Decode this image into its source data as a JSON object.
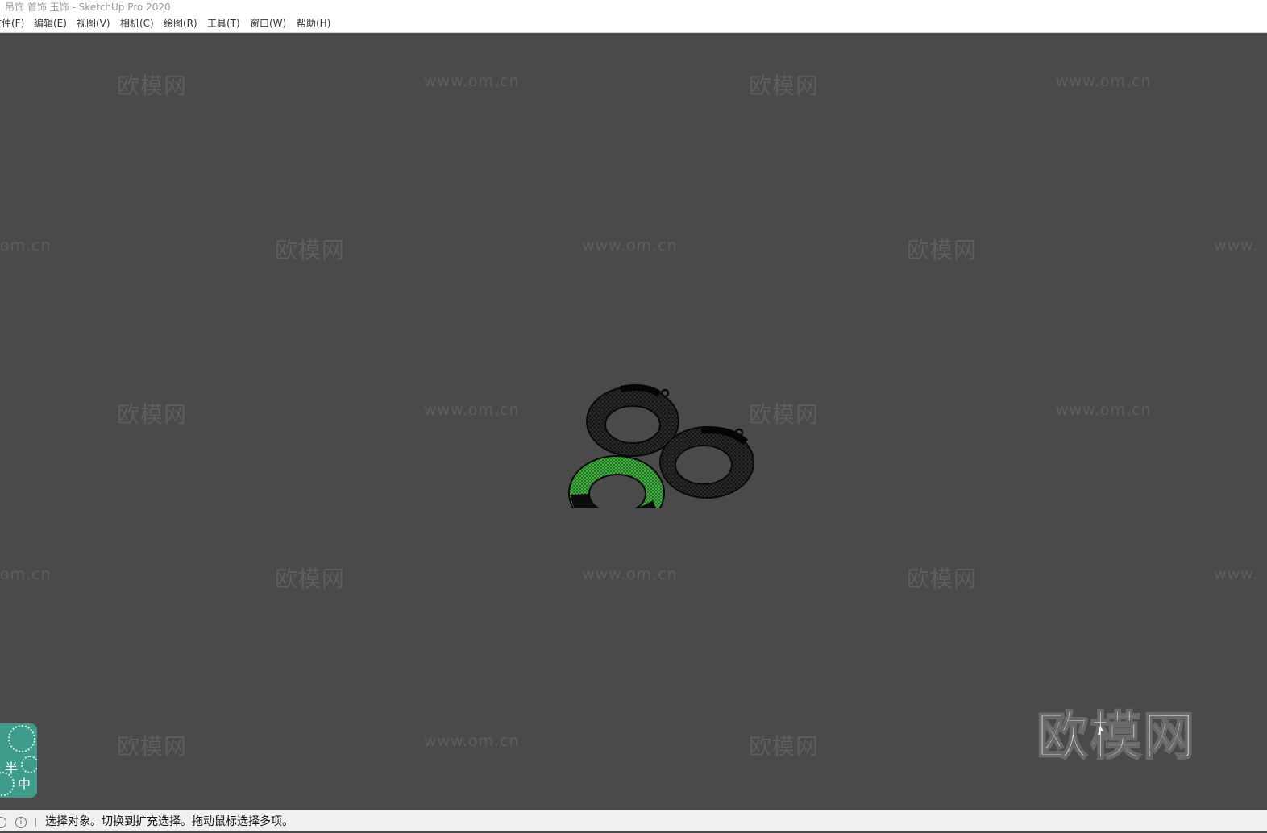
{
  "window": {
    "title": "吊饰 首饰 玉饰 - SketchUp Pro 2020"
  },
  "menu": {
    "items": [
      {
        "label": "文件(F)"
      },
      {
        "label": "编辑(E)"
      },
      {
        "label": "视图(V)"
      },
      {
        "label": "相机(C)"
      },
      {
        "label": "绘图(R)"
      },
      {
        "label": "工具(T)"
      },
      {
        "label": "窗口(W)"
      },
      {
        "label": "帮助(H)"
      }
    ]
  },
  "watermark": {
    "brand_text": "欧模网",
    "url_text": "www.om.cn",
    "url_partial_left": "om.cn",
    "url_partial_right": "www."
  },
  "logo": {
    "text": "欧模网"
  },
  "badge": {
    "char_top": "半",
    "char_bottom": "中"
  },
  "status": {
    "message": "选择对象。切换到扩充选择。拖动鼠标选择多项。",
    "info_icon": "info-icon",
    "geo_icon": "geolocation-icon"
  },
  "model": {
    "description_colors": {
      "ring": "#111111",
      "selected": "#2e8b2e"
    }
  }
}
